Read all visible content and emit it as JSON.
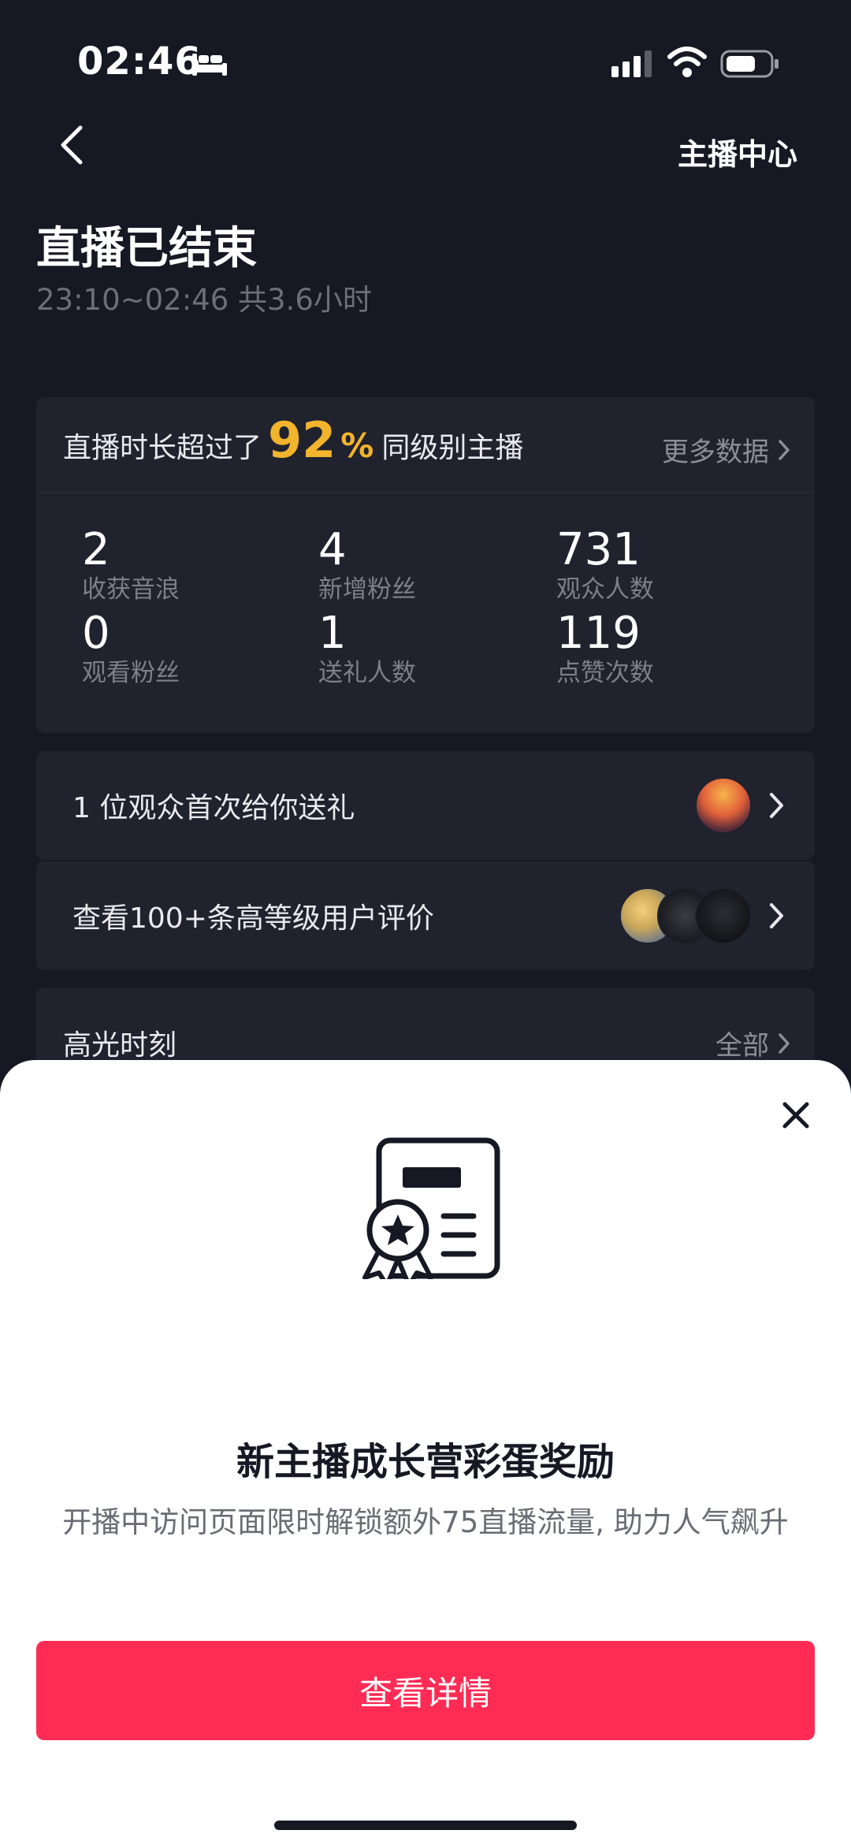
{
  "status_bar": {
    "time": "02:46",
    "icons": [
      "bed-icon",
      "signal-icon",
      "wifi-icon",
      "battery-icon"
    ]
  },
  "header": {
    "back_icon": "chevron-left-icon",
    "right_link": "主播中心"
  },
  "summary": {
    "title": "直播已结束",
    "subtitle": "23:10~02:46 共3.6小时"
  },
  "stats": {
    "headline_prefix": "直播时长超过了",
    "percent": "92",
    "percent_sign": "%",
    "headline_suffix": "同级别主播",
    "more_label": "更多数据",
    "metrics": [
      {
        "value": "2",
        "label": "收获音浪"
      },
      {
        "value": "4",
        "label": "新增粉丝"
      },
      {
        "value": "731",
        "label": "观众人数"
      },
      {
        "value": "0",
        "label": "观看粉丝"
      },
      {
        "value": "1",
        "label": "送礼人数"
      },
      {
        "value": "119",
        "label": "点赞次数"
      }
    ]
  },
  "rows": {
    "gift": "1 位观众首次给你送礼",
    "reviews": "查看100+条高等级用户评价"
  },
  "highlights": {
    "label": "高光时刻",
    "all_label": "全部"
  },
  "sheet": {
    "icon": "certificate-icon",
    "title": "新主播成长营彩蛋奖励",
    "description": "开播中访问页面限时解锁额外75直播流量, 助力人气飙升",
    "button_label": "查看详情"
  },
  "colors": {
    "background": "#161823",
    "card": "#20222d",
    "accent_gold": "#f2b42c",
    "primary_button": "#fe2c55"
  }
}
